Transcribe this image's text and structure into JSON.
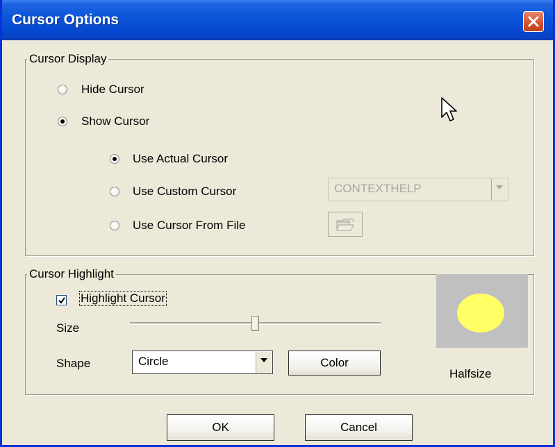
{
  "window": {
    "title": "Cursor Options"
  },
  "cursor_display": {
    "legend": "Cursor Display",
    "hide_cursor": {
      "label": "Hide Cursor",
      "checked": false
    },
    "show_cursor": {
      "label": "Show Cursor",
      "checked": true
    },
    "use_actual": {
      "label": "Use Actual Cursor",
      "checked": true
    },
    "use_custom": {
      "label": "Use Custom Cursor",
      "checked": false
    },
    "use_file": {
      "label": "Use Cursor From File",
      "checked": false
    },
    "custom_cursor_select": {
      "value": "CONTEXTHELP",
      "disabled": true
    }
  },
  "cursor_highlight": {
    "legend": "Cursor Highlight",
    "highlight_checkbox": {
      "label": "Highlight Cursor",
      "checked": true
    },
    "size_label": "Size",
    "size_slider_fraction": 0.51,
    "shape_label": "Shape",
    "shape_select": {
      "value": "Circle"
    },
    "color_button": "Color",
    "preview_caption": "Halfsize",
    "preview_color": "#FFFF66"
  },
  "buttons": {
    "ok": "OK",
    "cancel": "Cancel"
  },
  "icons": {
    "close": "close-icon",
    "folder": "folder-open-icon",
    "pointer": "mouse-pointer-icon"
  }
}
